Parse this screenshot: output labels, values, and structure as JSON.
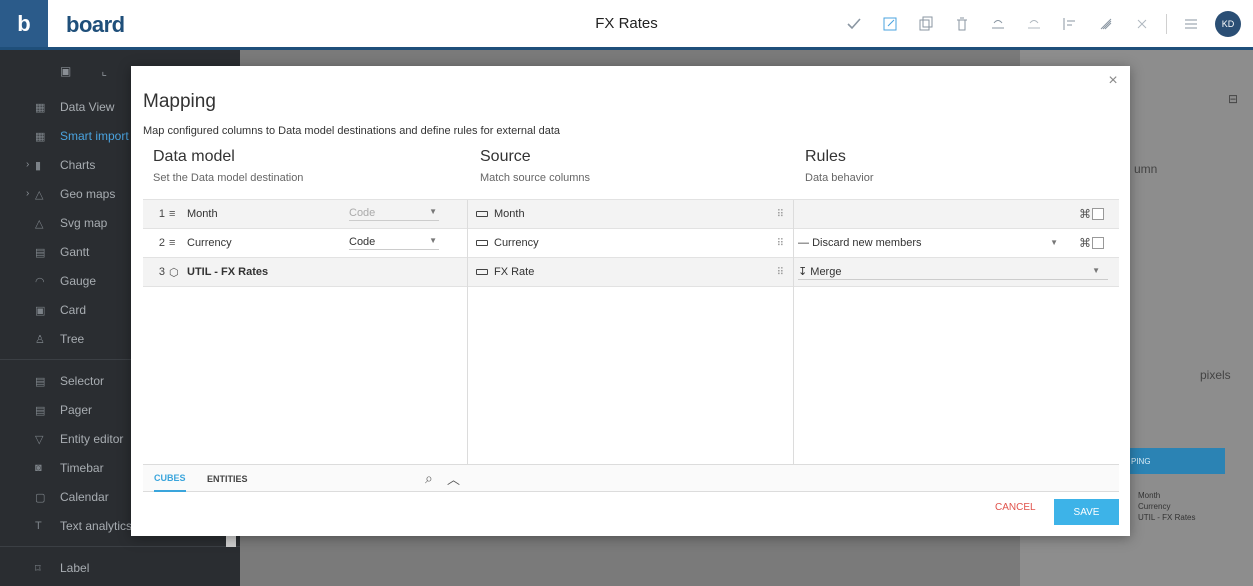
{
  "app": {
    "logo_letter": "b",
    "logo_word": "board",
    "title": "FX Rates",
    "avatar": "KD"
  },
  "toolbar": {
    "icons": [
      "check-icon",
      "resize-icon",
      "copy-icon",
      "trash-icon",
      "undo-icon",
      "redo-icon",
      "align-icon",
      "brush-icon",
      "close-icon",
      "menu-icon"
    ]
  },
  "sidebar": {
    "items": [
      {
        "label": "Data View"
      },
      {
        "label": "Smart import"
      },
      {
        "label": "Charts"
      },
      {
        "label": "Geo maps"
      },
      {
        "label": "Svg map"
      },
      {
        "label": "Gantt"
      },
      {
        "label": "Gauge"
      },
      {
        "label": "Card"
      },
      {
        "label": "Tree"
      },
      {
        "label": "Selector"
      },
      {
        "label": "Pager"
      },
      {
        "label": "Entity editor"
      },
      {
        "label": "Timebar"
      },
      {
        "label": "Calendar"
      },
      {
        "label": "Text analytics"
      },
      {
        "label": "Label"
      }
    ]
  },
  "right_panel": {
    "partial_label": "umn",
    "unit": "pixels",
    "button": "PING",
    "list": [
      "Month",
      "Currency",
      "UTIL - FX Rates"
    ]
  },
  "modal": {
    "title": "Mapping",
    "subtitle": "Map configured columns to Data model destinations and define rules for external data",
    "columns": {
      "data_model": {
        "title": "Data model",
        "subtitle": "Set the Data model destination"
      },
      "source": {
        "title": "Source",
        "subtitle": "Match source columns"
      },
      "rules": {
        "title": "Rules",
        "subtitle": "Data behavior"
      }
    },
    "rows": [
      {
        "num": "1",
        "name": "Month",
        "code": "Code",
        "source": "Month",
        "rule": ""
      },
      {
        "num": "2",
        "name": "Currency",
        "code": "Code",
        "source": "Currency",
        "rule": "Discard new members"
      },
      {
        "num": "3",
        "name": "UTIL - FX Rates",
        "code": "",
        "source": "FX Rate",
        "rule": "Merge"
      }
    ],
    "tabs": {
      "cubes": "CUBES",
      "entities": "ENTITIES"
    },
    "cancel": "CANCEL",
    "save": "SAVE"
  }
}
